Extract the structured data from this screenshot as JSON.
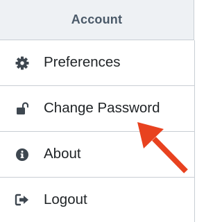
{
  "header": {
    "title": "Account"
  },
  "menu": {
    "items": [
      {
        "label": "Preferences",
        "icon": "gear-icon"
      },
      {
        "label": "Change Password",
        "icon": "unlock-icon"
      },
      {
        "label": "About",
        "icon": "info-icon"
      },
      {
        "label": "Logout",
        "icon": "logout-icon"
      }
    ]
  },
  "colors": {
    "header_bg": "#eef1f4",
    "header_text": "#4a5968",
    "item_text": "#1f2326",
    "icon": "#3e4750",
    "divider": "#c8ced4",
    "annotation_arrow": "#e8421f"
  }
}
